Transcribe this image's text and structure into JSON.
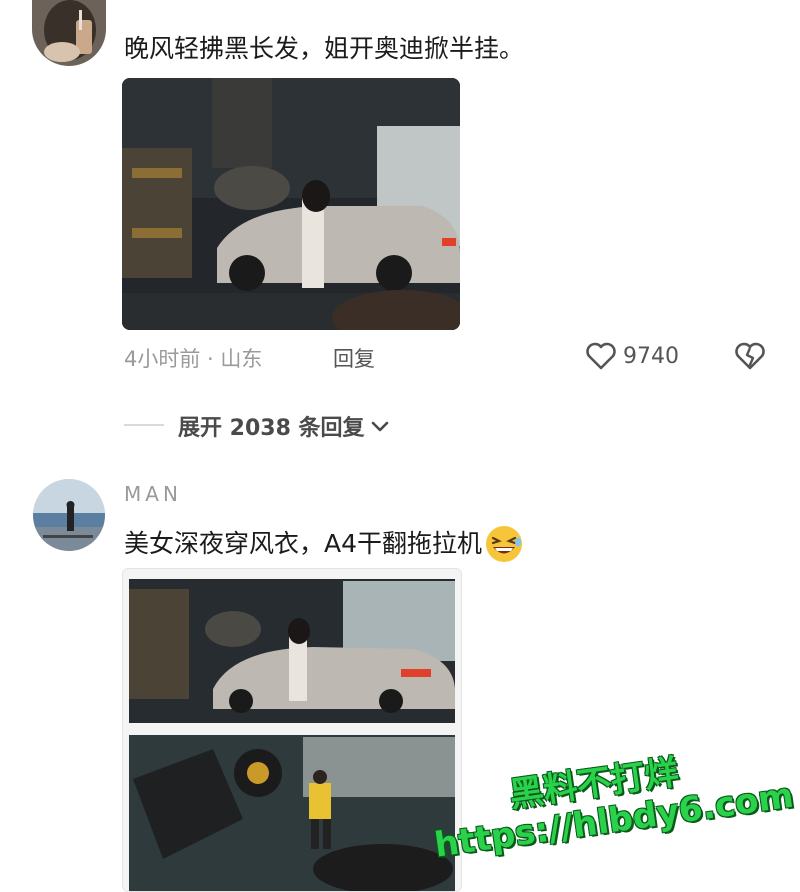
{
  "comment1": {
    "text": "晚风轻拂黑长发，姐开奥迪掀半挂。",
    "meta": "4小时前 · 山东",
    "reply_label": "回复",
    "like_count": "9740",
    "expand_label": "展开 2038 条回复"
  },
  "comment2": {
    "username": "MAN",
    "text": "美女深夜穿风衣，A4干翻拖拉机",
    "emoji": "😆"
  },
  "watermark": {
    "line1": "黑料不打烊",
    "line2": "https://hlbdy6.com"
  },
  "icons": {
    "like": "heart-outline-icon",
    "dislike": "broken-heart-icon",
    "expand": "chevron-down-icon"
  }
}
